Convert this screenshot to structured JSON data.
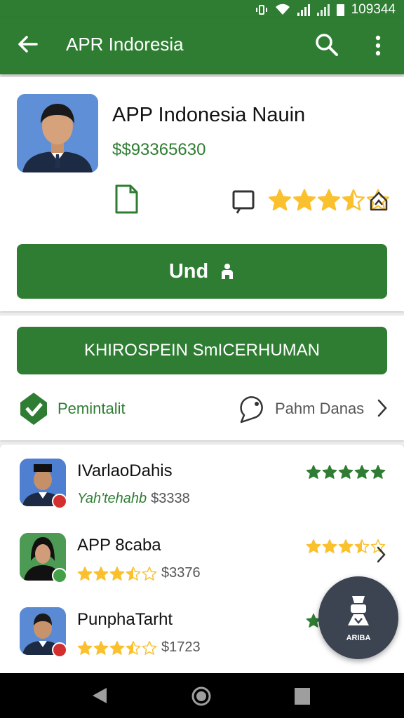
{
  "status_bar": {
    "time": "109344",
    "icons": [
      "vibrate-icon",
      "wifi-icon",
      "signal-icon",
      "signal-icon",
      "battery-icon"
    ]
  },
  "app_bar": {
    "title": "APR Indoresia",
    "icons": [
      "back-arrow-icon",
      "search-icon",
      "more-vert-icon"
    ]
  },
  "app": {
    "name": "APP Indonesia Nauin",
    "price": "$$93365630",
    "rating": 3.5,
    "primary_button": "Und",
    "secondary_button": "KHIROSPEIN SmICERHUMAN",
    "permission_label": "Pemintalit",
    "policy_label": "Pahm Danas"
  },
  "list": [
    {
      "name": "IVarlaoDahis",
      "sub_text": "Yah'tehahb",
      "price": "$3338",
      "rating": 5,
      "badge_color": "#d32f2f",
      "chevron": false
    },
    {
      "name": "APP 8caba",
      "sub_text": "",
      "price": "$3376",
      "rating": 3.5,
      "badge_color": "#43a047",
      "chevron": true
    },
    {
      "name": "PunphaTarht",
      "sub_text": "",
      "price": "$1723",
      "rating": 3.5,
      "badge_color": "#d32f2f",
      "chevron": false
    }
  ],
  "fab": {
    "label": "ARIBA",
    "icon": "robot-icon"
  },
  "colors": {
    "primary": "#2e7d32",
    "star": "#fbc02d",
    "fab": "#3c4452"
  }
}
